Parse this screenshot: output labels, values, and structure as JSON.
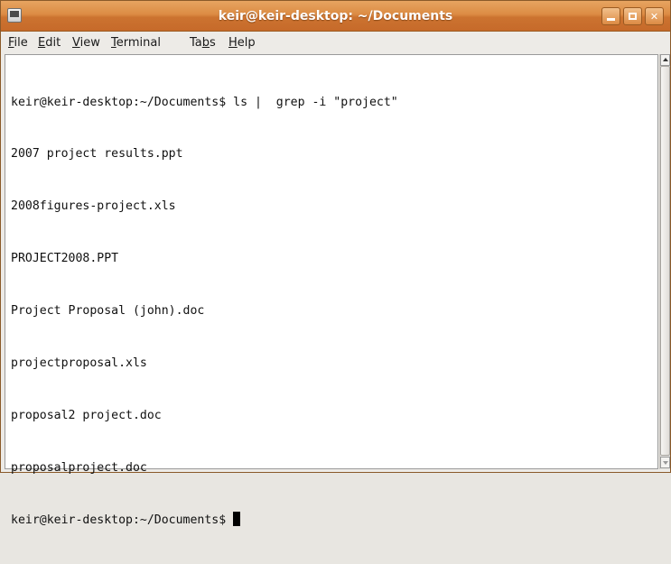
{
  "window": {
    "title": "keir@keir-desktop: ~/Documents",
    "accent_color": "#d3813a"
  },
  "menubar": {
    "items": [
      {
        "label": "File",
        "mnemonic_index": 0
      },
      {
        "label": "Edit",
        "mnemonic_index": 0
      },
      {
        "label": "View",
        "mnemonic_index": 0
      },
      {
        "label": "Terminal",
        "mnemonic_index": 0
      },
      {
        "label": "Tabs",
        "mnemonic_index": 2
      },
      {
        "label": "Help",
        "mnemonic_index": 0
      }
    ]
  },
  "terminal": {
    "lines": [
      "keir@keir-desktop:~/Documents$ ls |  grep -i \"project\"",
      "2007 project results.ppt",
      "2008figures-project.xls",
      "PROJECT2008.PPT",
      "Project Proposal (john).doc",
      "projectproposal.xls",
      "proposal2 project.doc",
      "proposalproject.doc"
    ],
    "prompt": "keir@keir-desktop:~/Documents$ "
  }
}
